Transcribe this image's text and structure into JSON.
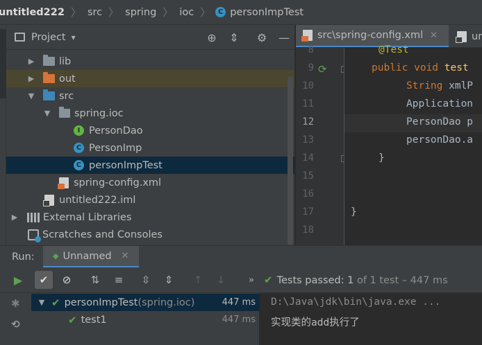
{
  "breadcrumb": {
    "project": "untitled222",
    "p1": "src",
    "p2": "spring",
    "p3": "ioc",
    "file": "personImpTest"
  },
  "project": {
    "title": "Project",
    "dropdown_glyph": "▾",
    "header_icons": [
      "locate-icon",
      "collapse-icon",
      "gear-icon",
      "minimize-icon"
    ],
    "tree": [
      {
        "label": "lib"
      },
      {
        "label": "out"
      },
      {
        "label": "src"
      },
      {
        "label": "spring.ioc"
      },
      {
        "label": "PersonDao"
      },
      {
        "label": "PersonImp"
      },
      {
        "label": "personImpTest"
      },
      {
        "label": "spring-config.xml"
      },
      {
        "label": "untitled222.iml"
      },
      {
        "label": "External Libraries"
      },
      {
        "label": "Scratches and Consoles"
      }
    ]
  },
  "editor": {
    "tabs": [
      {
        "label": "src\\spring-config.xml"
      },
      {
        "label": "un"
      }
    ],
    "line_numbers": [
      "8",
      "9",
      "10",
      "11",
      "12",
      "13",
      "14",
      "15",
      "16",
      "17",
      "18"
    ],
    "current_line": "12",
    "code": {
      "l8": "@Test",
      "l9_kw": "public void ",
      "l9_fn": "test",
      "l10_kw": "String ",
      "l10_rest": "xmlP",
      "l11": "Application",
      "l12": "PersonDao p",
      "l13": "personDao.a",
      "l14": "}",
      "l17": "}"
    }
  },
  "run": {
    "label": "Run:",
    "tab": "Unnamed",
    "status_main": "Tests passed: 1",
    "status_rest": " of 1 test – 447 ms",
    "more_glyph": "»",
    "tests": [
      {
        "name": "personImpTest",
        "suffix": " (spring.ioc)",
        "duration": "447 ms"
      },
      {
        "name": "test1",
        "suffix": "",
        "duration": "447 ms"
      }
    ],
    "console": [
      "D:\\Java\\jdk\\bin\\java.exe ...",
      "实现类的add执行了"
    ]
  },
  "colors": {
    "selection": "#0d293e",
    "accent": "#4a88c7",
    "pass": "#5ea14e",
    "keyword": "#cc7832"
  }
}
